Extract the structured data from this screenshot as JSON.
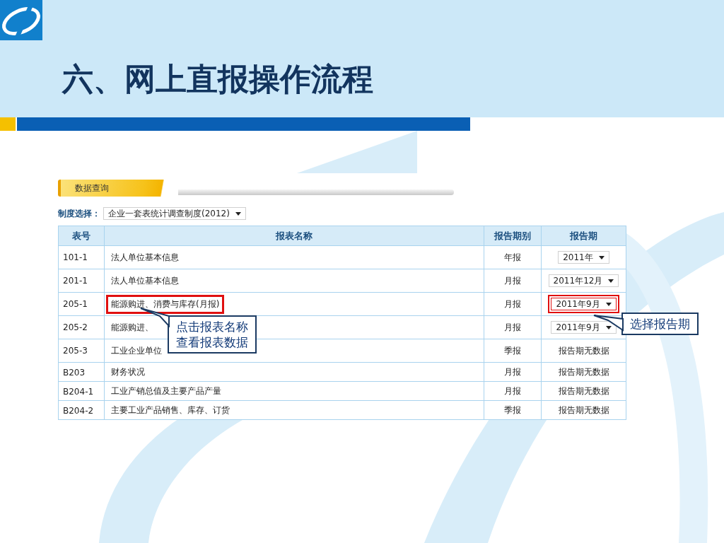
{
  "slide": {
    "title": "六、网上直报操作流程"
  },
  "panel": {
    "tab": "数据查询",
    "system_label": "制度选择：",
    "system_value": "企业一套表统计调查制度(2012)"
  },
  "table": {
    "columns": [
      "表号",
      "报表名称",
      "报告期别",
      "报告期"
    ],
    "rows": [
      {
        "code": "101-1",
        "name": "法人单位基本信息",
        "frequency": "年报",
        "period": {
          "kind": "select",
          "text": "2011年"
        },
        "highlighted": false
      },
      {
        "code": "201-1",
        "name": "法人单位基本信息",
        "frequency": "月报",
        "period": {
          "kind": "select",
          "text": "2011年12月"
        },
        "highlighted": false
      },
      {
        "code": "205-1",
        "name": "能源购进、消费与库存(月报)",
        "frequency": "月报",
        "period": {
          "kind": "select",
          "text": "2011年9月"
        },
        "highlighted": true
      },
      {
        "code": "205-2",
        "name": "能源购进、",
        "frequency": "月报",
        "period": {
          "kind": "select",
          "text": "2011年9月"
        },
        "highlighted": false
      },
      {
        "code": "205-3",
        "name": "工业企业单位",
        "frequency": "季报",
        "period": {
          "kind": "text",
          "text": "报告期无数据"
        },
        "highlighted": false
      },
      {
        "code": "B203",
        "name": "财务状况",
        "frequency": "月报",
        "period": {
          "kind": "text",
          "text": "报告期无数据"
        },
        "highlighted": false
      },
      {
        "code": "B204-1",
        "name": "工业产销总值及主要产品产量",
        "frequency": "月报",
        "period": {
          "kind": "text",
          "text": "报告期无数据"
        },
        "highlighted": false
      },
      {
        "code": "B204-2",
        "name": "主要工业产品销售、库存、订货",
        "frequency": "季报",
        "period": {
          "kind": "text",
          "text": "报告期无数据"
        },
        "highlighted": false
      }
    ]
  },
  "callouts": [
    {
      "lines": [
        "点击报表名称",
        "查看报表数据"
      ]
    },
    {
      "lines": [
        "选择报告期"
      ]
    }
  ]
}
